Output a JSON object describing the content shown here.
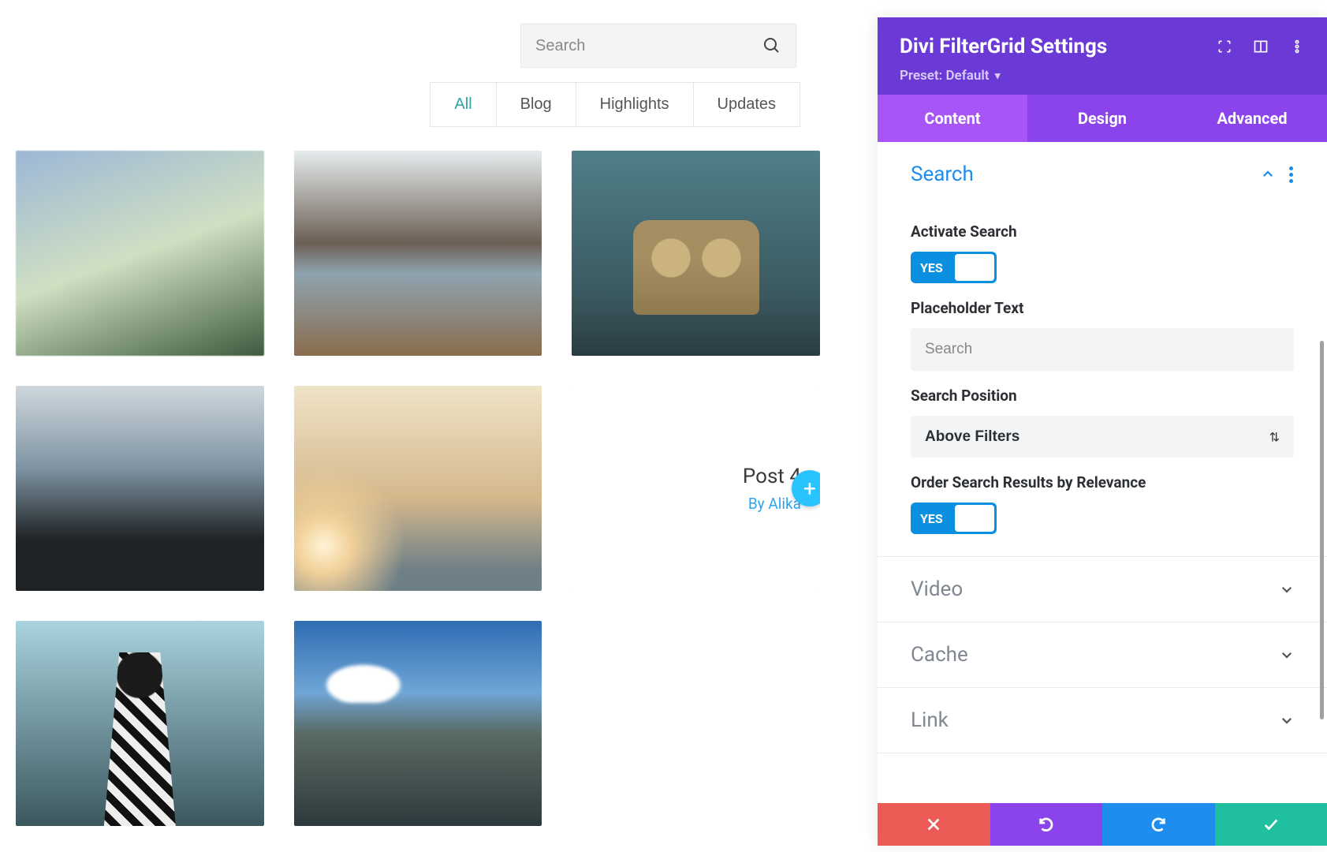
{
  "search": {
    "placeholder": "Search"
  },
  "filters": [
    "All",
    "Blog",
    "Highlights",
    "Updates"
  ],
  "hover": {
    "title": "Post 4",
    "meta_prefix": "By ",
    "meta_name": "Alika"
  },
  "panel": {
    "title": "Divi FilterGrid Settings",
    "preset_label": "Preset: Default",
    "tabs": [
      "Content",
      "Design",
      "Advanced"
    ],
    "sections": {
      "search": {
        "title": "Search",
        "activate_label": "Activate Search",
        "activate_value": "YES",
        "placeholder_label": "Placeholder Text",
        "placeholder_value": "Search",
        "position_label": "Search Position",
        "position_value": "Above Filters",
        "order_label": "Order Search Results by Relevance",
        "order_value": "YES"
      },
      "video": {
        "title": "Video"
      },
      "cache": {
        "title": "Cache"
      },
      "link": {
        "title": "Link"
      }
    }
  }
}
